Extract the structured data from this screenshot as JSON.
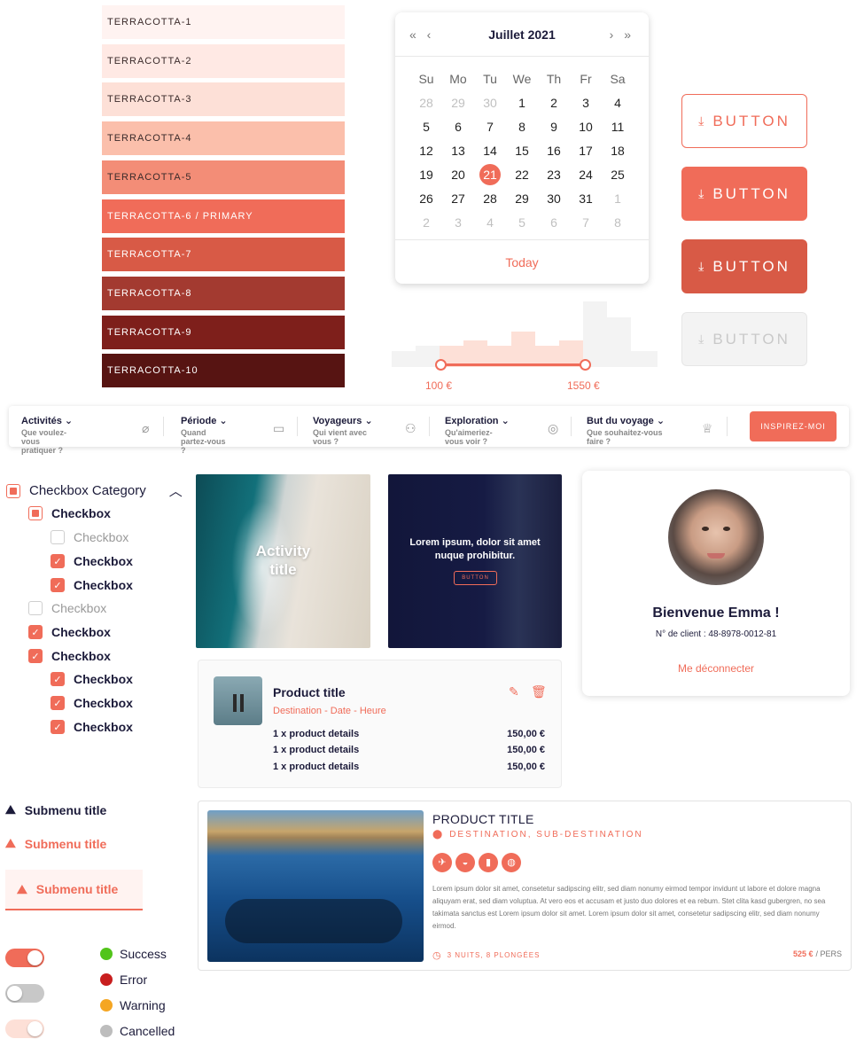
{
  "palette": [
    {
      "label": "TERRACOTTA-1",
      "color": "#fff3f1",
      "text": "#3a2a2a"
    },
    {
      "label": "TERRACOTTA-2",
      "color": "#ffe9e4",
      "text": "#3a2a2a"
    },
    {
      "label": "TERRACOTTA-3",
      "color": "#fde0d7",
      "text": "#3a2a2a"
    },
    {
      "label": "TERRACOTTA-4",
      "color": "#fbbfab",
      "text": "#3a2a2a"
    },
    {
      "label": "TERRACOTTA-5",
      "color": "#f38d77",
      "text": "#3a2a2a"
    },
    {
      "label": "TERRACOTTA-6 / PRIMARY",
      "color": "#f06c59",
      "text": "#ffffff"
    },
    {
      "label": "TERRACOTTA-7",
      "color": "#d85a46",
      "text": "#ffffff"
    },
    {
      "label": "TERRACOTTA-8",
      "color": "#a33a30",
      "text": "#ffffff"
    },
    {
      "label": "TERRACOTTA-9",
      "color": "#7e1f1b",
      "text": "#ffffff"
    },
    {
      "label": "TERRACOTTA-10",
      "color": "#571412",
      "text": "#ffffff"
    }
  ],
  "calendar": {
    "title": "Juillet 2021",
    "prev": "« ‹",
    "next": "› »",
    "weekdays": [
      "Su",
      "Mo",
      "Tu",
      "We",
      "Th",
      "Fr",
      "Sa"
    ],
    "weeks": [
      [
        {
          "d": "28",
          "m": true
        },
        {
          "d": "29",
          "m": true
        },
        {
          "d": "30",
          "m": true
        },
        {
          "d": "1"
        },
        {
          "d": "2"
        },
        {
          "d": "3"
        },
        {
          "d": "4"
        }
      ],
      [
        {
          "d": "5"
        },
        {
          "d": "6"
        },
        {
          "d": "7"
        },
        {
          "d": "8"
        },
        {
          "d": "9"
        },
        {
          "d": "10"
        },
        {
          "d": "11"
        }
      ],
      [
        {
          "d": "12"
        },
        {
          "d": "13"
        },
        {
          "d": "14"
        },
        {
          "d": "15"
        },
        {
          "d": "16"
        },
        {
          "d": "17"
        },
        {
          "d": "18"
        }
      ],
      [
        {
          "d": "19"
        },
        {
          "d": "20"
        },
        {
          "d": "21",
          "s": true
        },
        {
          "d": "22"
        },
        {
          "d": "23"
        },
        {
          "d": "24"
        },
        {
          "d": "25"
        }
      ],
      [
        {
          "d": "26"
        },
        {
          "d": "27"
        },
        {
          "d": "28"
        },
        {
          "d": "29"
        },
        {
          "d": "30"
        },
        {
          "d": "31"
        },
        {
          "d": "1",
          "m": true
        }
      ],
      [
        {
          "d": "2",
          "m": true
        },
        {
          "d": "3",
          "m": true
        },
        {
          "d": "4",
          "m": true
        },
        {
          "d": "5",
          "m": true
        },
        {
          "d": "6",
          "m": true
        },
        {
          "d": "7",
          "m": true
        },
        {
          "d": "8",
          "m": true
        }
      ]
    ],
    "today": "Today"
  },
  "buttons": {
    "label": "BUTTON",
    "icon": "download-icon"
  },
  "slider": {
    "min_label": "100 €",
    "max_label": "1550 €"
  },
  "search": {
    "fields": [
      {
        "label": "Activités",
        "sub": "Que voulez-vous pratiquer ?",
        "icon": "surfboard-icon"
      },
      {
        "label": "Période",
        "sub": "Quand partez-vous ?",
        "icon": "calendar-icon"
      },
      {
        "label": "Voyageurs",
        "sub": "Qui vient avec vous ?",
        "icon": "travelers-icon"
      },
      {
        "label": "Exploration",
        "sub": "Qu'aimeriez-vous voir ?",
        "icon": "eye-icon"
      },
      {
        "label": "But du voyage",
        "sub": "Que souhaitez-vous faire ?",
        "icon": "trophy-icon"
      }
    ],
    "cta": "INSPIREZ-MOI"
  },
  "checkboxes": {
    "category": "Checkbox Category",
    "item": "Checkbox"
  },
  "activity_card": {
    "title": "Activity title"
  },
  "promo_card": {
    "text": "Lorem ipsum, dolor sit amet nuque prohibitur.",
    "button": "BUTTON"
  },
  "product_card": {
    "title": "Product title",
    "meta": "Destination - Date - Heure",
    "lines": [
      {
        "text": "1 x product details",
        "price": "150,00 €"
      },
      {
        "text": "1 x product details",
        "price": "150,00 €"
      },
      {
        "text": "1 x product details",
        "price": "150,00 €"
      }
    ]
  },
  "profile": {
    "greeting": "Bienvenue Emma !",
    "client": "N° de client : 48-8978-0012-81",
    "logout": "Me déconnecter"
  },
  "wide_card": {
    "title": "PRODUCT TITLE",
    "destination": "DESTINATION, SUB-DESTINATION",
    "description": "Lorem ipsum dolor sit amet, consetetur sadipscing elitr, sed diam nonumy eirmod tempor invidunt ut labore et dolore magna aliquyam erat, sed diam voluptua. At vero eos et accusam et justo duo dolores et ea rebum. Stet clita kasd gubergren, no sea takimata sanctus est Lorem ipsum dolor sit amet. Lorem ipsum dolor sit amet, consetetur sadipscing elitr, sed diam nonumy eirmod.",
    "duration": "3 NUITS, 8 PLONGÉES",
    "price": "525 €",
    "price_unit": "/ PERS"
  },
  "submenu": {
    "title": "Submenu title"
  },
  "statuses": [
    {
      "label": "Success",
      "color": "#52c41a"
    },
    {
      "label": "Error",
      "color": "#c81e1e"
    },
    {
      "label": "Warning",
      "color": "#f5a623"
    },
    {
      "label": "Cancelled",
      "color": "#bdbdbd"
    }
  ],
  "colors": {
    "primary": "#f06c59",
    "dark": "#1c1b3a"
  }
}
